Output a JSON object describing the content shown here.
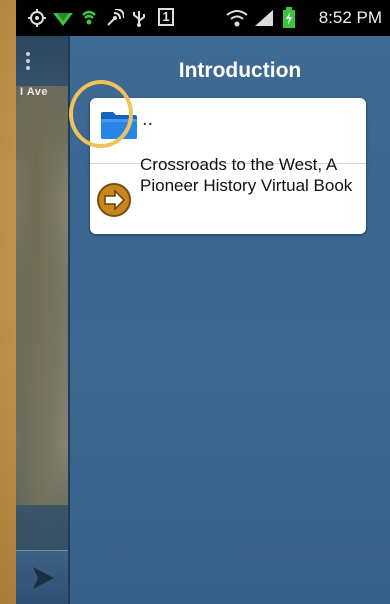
{
  "status_bar": {
    "time": "8:52 PM",
    "icons": [
      "gps-icon",
      "wifi-signal-icon",
      "sync-icon",
      "nfc-icon",
      "usb-icon",
      "notification-1-icon",
      "wifi-icon",
      "cell-signal-icon",
      "battery-charging-icon"
    ],
    "notification_badge": "1"
  },
  "map": {
    "road_label": "I Ave",
    "expand_icon": "play-arrow-icon"
  },
  "panel": {
    "title": "Introduction",
    "items": [
      {
        "label": "..",
        "icon": "folder-icon",
        "kind": "parent-folder"
      },
      {
        "label": "Crossroads to the West, A Pioneer History Virtual Book",
        "icon": "arrow-circle-icon",
        "kind": "book"
      }
    ]
  },
  "colors": {
    "panel_blue": "#3c6891",
    "folder_blue": "#1a73d9",
    "arrow_orange": "#c8861e",
    "highlight": "#f0c35a",
    "background_gold": "#c49a4f"
  }
}
